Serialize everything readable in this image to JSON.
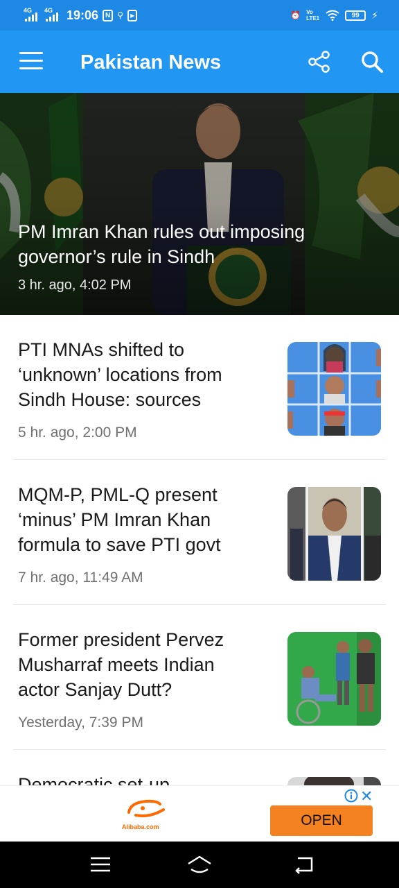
{
  "status_bar": {
    "network1": "4G",
    "network2": "4G",
    "time": "19:06",
    "badge": "N",
    "lte_label": "Vo LTE1",
    "battery": "99"
  },
  "app_bar": {
    "title": "Pakistan News",
    "menu_icon": "hamburger-menu-icon",
    "share_icon": "share-icon",
    "search_icon": "search-icon",
    "color": "#2196f3"
  },
  "hero": {
    "title": "PM Imran Khan rules out imposing governor’s rule in Sindh",
    "time": "3 hr. ago, 4:02 PM"
  },
  "news": [
    {
      "title": "PTI MNAs shifted to ‘unknown’ locations from Sindh House: sources",
      "time": "5 hr. ago, 2:00 PM"
    },
    {
      "title": "MQM-P, PML-Q present ‘minus’ PM Imran Khan formula to save PTI govt",
      "time": "7 hr. ago, 11:49 AM"
    },
    {
      "title": "Former president Pervez Musharraf meets Indian actor Sanjay Dutt?",
      "time": "Yesterday, 7:39 PM"
    },
    {
      "title": "Democratic set-up",
      "time": ""
    }
  ],
  "ad": {
    "brand": "Alibaba.com",
    "button": "OPEN",
    "info_icon": "info-icon",
    "close_icon": "close-icon",
    "accent": "#f58220"
  },
  "nav_bar": {
    "recent_icon": "recent-apps-icon",
    "home_icon": "home-icon",
    "back_icon": "back-icon"
  }
}
